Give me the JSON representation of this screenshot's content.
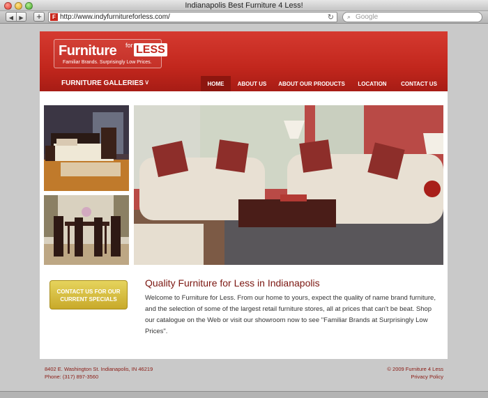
{
  "window": {
    "title": "Indianapolis Best Furniture 4 Less!"
  },
  "toolbar": {
    "back_glyph": "◀",
    "forward_glyph": "▶",
    "add_glyph": "+",
    "favicon_glyph": "F",
    "url": "http://www.indyfurnitureforless.com/",
    "reload_glyph": "↻",
    "search_glyph": "⌕",
    "search_placeholder": "Google"
  },
  "header": {
    "logo": {
      "main": "Furniture",
      "for": "for",
      "less": "LESS",
      "tagline": "Familiar Brands. Surprisingly Low Prices."
    },
    "galleries_label": "FURNITURE GALLERIES",
    "galleries_chevron": "∨",
    "nav": [
      {
        "label": "HOME",
        "active": true
      },
      {
        "label": "ABOUT US"
      },
      {
        "label": "ABOUT OUR PRODUCTS"
      },
      {
        "label": "LOCATION"
      },
      {
        "label": "CONTACT US"
      }
    ]
  },
  "cta": {
    "line1": "CONTACT US FOR OUR",
    "line2": "CURRENT SPECIALS"
  },
  "main": {
    "heading": "Quality Furniture for Less in Indianapolis",
    "body": "Welcome to Furniture for Less. From our home to yours, expect the quality of name brand furniture, and the selection of some of the largest retail furniture stores, all at prices that can't be beat. Shop our catalogue on the Web or visit our showroom now to see \"Familiar Brands at Surprisingly Low Prices\"."
  },
  "footer": {
    "address": "8402 E. Washington St. Indianapolis, IN 46219",
    "phone": "Phone: (317) 897-3560",
    "copyright": "© 2009 Furniture 4 Less",
    "privacy": "Privacy Policy"
  },
  "colors": {
    "header_red": "#c2271d",
    "nav_active": "#8d160f",
    "heading_maroon": "#7b1610",
    "cta_gold": "#d6bd3c"
  }
}
